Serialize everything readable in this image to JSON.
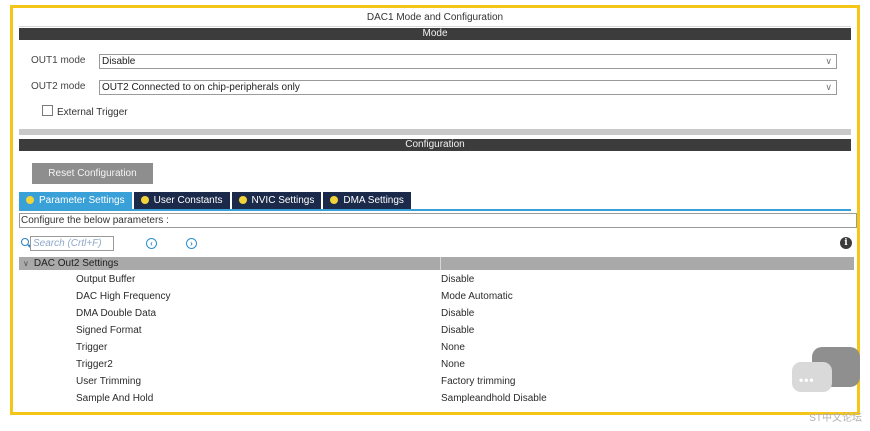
{
  "window": {
    "title": "DAC1 Mode and Configuration"
  },
  "mode_section": {
    "header": "Mode",
    "out1": {
      "label": "OUT1 mode",
      "value": "Disable"
    },
    "out2": {
      "label": "OUT2 mode",
      "value": "OUT2 Connected to on chip-peripherals only"
    },
    "external_trigger": {
      "label": "External Trigger",
      "checked": false
    }
  },
  "config_section": {
    "header": "Configuration",
    "reset_button": "Reset Configuration",
    "tabs": [
      {
        "label": "Parameter Settings",
        "active": true
      },
      {
        "label": "User Constants",
        "active": false
      },
      {
        "label": "NVIC Settings",
        "active": false
      },
      {
        "label": "DMA Settings",
        "active": false
      }
    ],
    "info_text": "Configure the below parameters :",
    "search": {
      "placeholder": "Search (Crtl+F)"
    },
    "group": {
      "title": "DAC Out2 Settings",
      "params": [
        {
          "name": "Output Buffer",
          "value": "Disable"
        },
        {
          "name": "DAC High Frequency",
          "value": "Mode Automatic"
        },
        {
          "name": "DMA Double Data",
          "value": "Disable"
        },
        {
          "name": "Signed Format",
          "value": "Disable"
        },
        {
          "name": "Trigger",
          "value": "None"
        },
        {
          "name": "Trigger2",
          "value": "None"
        },
        {
          "name": "User Trimming",
          "value": "Factory trimming"
        },
        {
          "name": "Sample And Hold",
          "value": "Sampleandhold Disable"
        }
      ]
    }
  },
  "watermark": "ST中文论坛",
  "colors": {
    "frame": "#f5c518",
    "tab_active": "#3aa0d8",
    "tab_inactive": "#1b2a4a",
    "tab_dot": "#f2d43a"
  }
}
